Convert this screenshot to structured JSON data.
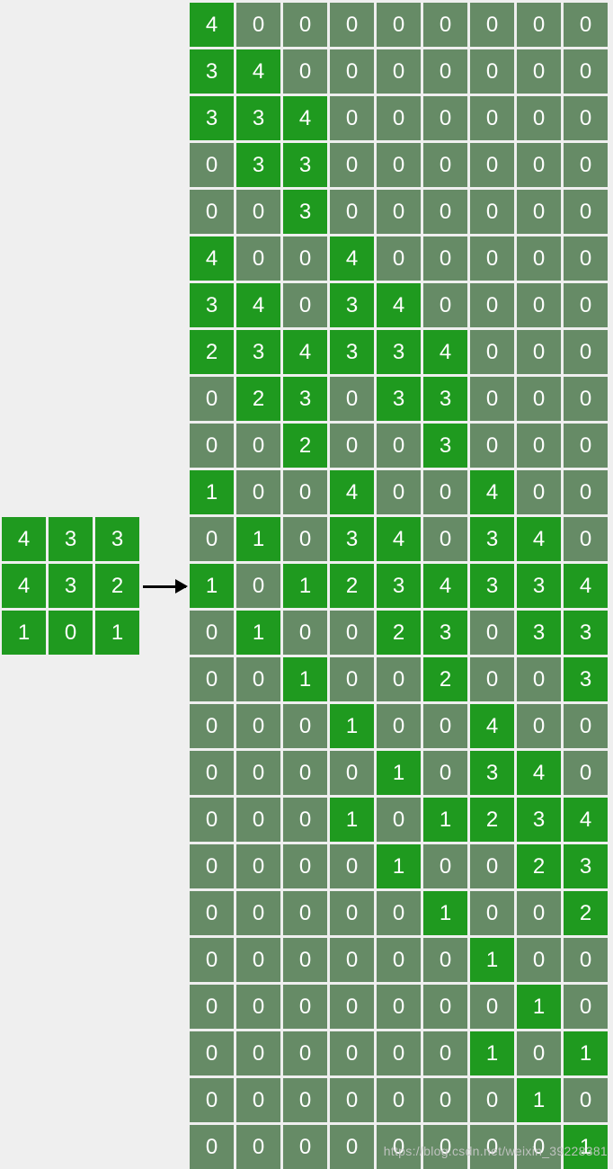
{
  "watermark": "https://blog.csdn.net/weixin_39228381",
  "left_matrix": {
    "rows": 3,
    "cols": 3,
    "cells": [
      [
        {
          "v": 4,
          "b": true
        },
        {
          "v": 3,
          "b": true
        },
        {
          "v": 3,
          "b": true
        }
      ],
      [
        {
          "v": 4,
          "b": true
        },
        {
          "v": 3,
          "b": true
        },
        {
          "v": 2,
          "b": true
        }
      ],
      [
        {
          "v": 1,
          "b": true
        },
        {
          "v": 0,
          "b": true
        },
        {
          "v": 1,
          "b": true
        }
      ]
    ]
  },
  "right_matrix": {
    "rows": 25,
    "cols": 9,
    "cells": [
      [
        {
          "v": 4,
          "b": true
        },
        {
          "v": 0,
          "b": false
        },
        {
          "v": 0,
          "b": false
        },
        {
          "v": 0,
          "b": false
        },
        {
          "v": 0,
          "b": false
        },
        {
          "v": 0,
          "b": false
        },
        {
          "v": 0,
          "b": false
        },
        {
          "v": 0,
          "b": false
        },
        {
          "v": 0,
          "b": false
        }
      ],
      [
        {
          "v": 3,
          "b": true
        },
        {
          "v": 4,
          "b": true
        },
        {
          "v": 0,
          "b": false
        },
        {
          "v": 0,
          "b": false
        },
        {
          "v": 0,
          "b": false
        },
        {
          "v": 0,
          "b": false
        },
        {
          "v": 0,
          "b": false
        },
        {
          "v": 0,
          "b": false
        },
        {
          "v": 0,
          "b": false
        }
      ],
      [
        {
          "v": 3,
          "b": true
        },
        {
          "v": 3,
          "b": true
        },
        {
          "v": 4,
          "b": true
        },
        {
          "v": 0,
          "b": false
        },
        {
          "v": 0,
          "b": false
        },
        {
          "v": 0,
          "b": false
        },
        {
          "v": 0,
          "b": false
        },
        {
          "v": 0,
          "b": false
        },
        {
          "v": 0,
          "b": false
        }
      ],
      [
        {
          "v": 0,
          "b": false
        },
        {
          "v": 3,
          "b": true
        },
        {
          "v": 3,
          "b": true
        },
        {
          "v": 0,
          "b": false
        },
        {
          "v": 0,
          "b": false
        },
        {
          "v": 0,
          "b": false
        },
        {
          "v": 0,
          "b": false
        },
        {
          "v": 0,
          "b": false
        },
        {
          "v": 0,
          "b": false
        }
      ],
      [
        {
          "v": 0,
          "b": false
        },
        {
          "v": 0,
          "b": false
        },
        {
          "v": 3,
          "b": true
        },
        {
          "v": 0,
          "b": false
        },
        {
          "v": 0,
          "b": false
        },
        {
          "v": 0,
          "b": false
        },
        {
          "v": 0,
          "b": false
        },
        {
          "v": 0,
          "b": false
        },
        {
          "v": 0,
          "b": false
        }
      ],
      [
        {
          "v": 4,
          "b": true
        },
        {
          "v": 0,
          "b": false
        },
        {
          "v": 0,
          "b": false
        },
        {
          "v": 4,
          "b": true
        },
        {
          "v": 0,
          "b": false
        },
        {
          "v": 0,
          "b": false
        },
        {
          "v": 0,
          "b": false
        },
        {
          "v": 0,
          "b": false
        },
        {
          "v": 0,
          "b": false
        }
      ],
      [
        {
          "v": 3,
          "b": true
        },
        {
          "v": 4,
          "b": true
        },
        {
          "v": 0,
          "b": false
        },
        {
          "v": 3,
          "b": true
        },
        {
          "v": 4,
          "b": true
        },
        {
          "v": 0,
          "b": false
        },
        {
          "v": 0,
          "b": false
        },
        {
          "v": 0,
          "b": false
        },
        {
          "v": 0,
          "b": false
        }
      ],
      [
        {
          "v": 2,
          "b": true
        },
        {
          "v": 3,
          "b": true
        },
        {
          "v": 4,
          "b": true
        },
        {
          "v": 3,
          "b": true
        },
        {
          "v": 3,
          "b": true
        },
        {
          "v": 4,
          "b": true
        },
        {
          "v": 0,
          "b": false
        },
        {
          "v": 0,
          "b": false
        },
        {
          "v": 0,
          "b": false
        }
      ],
      [
        {
          "v": 0,
          "b": false
        },
        {
          "v": 2,
          "b": true
        },
        {
          "v": 3,
          "b": true
        },
        {
          "v": 0,
          "b": false
        },
        {
          "v": 3,
          "b": true
        },
        {
          "v": 3,
          "b": true
        },
        {
          "v": 0,
          "b": false
        },
        {
          "v": 0,
          "b": false
        },
        {
          "v": 0,
          "b": false
        }
      ],
      [
        {
          "v": 0,
          "b": false
        },
        {
          "v": 0,
          "b": false
        },
        {
          "v": 2,
          "b": true
        },
        {
          "v": 0,
          "b": false
        },
        {
          "v": 0,
          "b": false
        },
        {
          "v": 3,
          "b": true
        },
        {
          "v": 0,
          "b": false
        },
        {
          "v": 0,
          "b": false
        },
        {
          "v": 0,
          "b": false
        }
      ],
      [
        {
          "v": 1,
          "b": true
        },
        {
          "v": 0,
          "b": false
        },
        {
          "v": 0,
          "b": false
        },
        {
          "v": 4,
          "b": true
        },
        {
          "v": 0,
          "b": false
        },
        {
          "v": 0,
          "b": false
        },
        {
          "v": 4,
          "b": true
        },
        {
          "v": 0,
          "b": false
        },
        {
          "v": 0,
          "b": false
        }
      ],
      [
        {
          "v": 0,
          "b": false
        },
        {
          "v": 1,
          "b": true
        },
        {
          "v": 0,
          "b": false
        },
        {
          "v": 3,
          "b": true
        },
        {
          "v": 4,
          "b": true
        },
        {
          "v": 0,
          "b": false
        },
        {
          "v": 3,
          "b": true
        },
        {
          "v": 4,
          "b": true
        },
        {
          "v": 0,
          "b": false
        }
      ],
      [
        {
          "v": 1,
          "b": true
        },
        {
          "v": 0,
          "b": false
        },
        {
          "v": 1,
          "b": true
        },
        {
          "v": 2,
          "b": true
        },
        {
          "v": 3,
          "b": true
        },
        {
          "v": 4,
          "b": true
        },
        {
          "v": 3,
          "b": true
        },
        {
          "v": 3,
          "b": true
        },
        {
          "v": 4,
          "b": true
        }
      ],
      [
        {
          "v": 0,
          "b": false
        },
        {
          "v": 1,
          "b": true
        },
        {
          "v": 0,
          "b": false
        },
        {
          "v": 0,
          "b": false
        },
        {
          "v": 2,
          "b": true
        },
        {
          "v": 3,
          "b": true
        },
        {
          "v": 0,
          "b": false
        },
        {
          "v": 3,
          "b": true
        },
        {
          "v": 3,
          "b": true
        }
      ],
      [
        {
          "v": 0,
          "b": false
        },
        {
          "v": 0,
          "b": false
        },
        {
          "v": 1,
          "b": true
        },
        {
          "v": 0,
          "b": false
        },
        {
          "v": 0,
          "b": false
        },
        {
          "v": 2,
          "b": true
        },
        {
          "v": 0,
          "b": false
        },
        {
          "v": 0,
          "b": false
        },
        {
          "v": 3,
          "b": true
        }
      ],
      [
        {
          "v": 0,
          "b": false
        },
        {
          "v": 0,
          "b": false
        },
        {
          "v": 0,
          "b": false
        },
        {
          "v": 1,
          "b": true
        },
        {
          "v": 0,
          "b": false
        },
        {
          "v": 0,
          "b": false
        },
        {
          "v": 4,
          "b": true
        },
        {
          "v": 0,
          "b": false
        },
        {
          "v": 0,
          "b": false
        }
      ],
      [
        {
          "v": 0,
          "b": false
        },
        {
          "v": 0,
          "b": false
        },
        {
          "v": 0,
          "b": false
        },
        {
          "v": 0,
          "b": false
        },
        {
          "v": 1,
          "b": true
        },
        {
          "v": 0,
          "b": false
        },
        {
          "v": 3,
          "b": true
        },
        {
          "v": 4,
          "b": true
        },
        {
          "v": 0,
          "b": false
        }
      ],
      [
        {
          "v": 0,
          "b": false
        },
        {
          "v": 0,
          "b": false
        },
        {
          "v": 0,
          "b": false
        },
        {
          "v": 1,
          "b": true
        },
        {
          "v": 0,
          "b": false
        },
        {
          "v": 1,
          "b": true
        },
        {
          "v": 2,
          "b": true
        },
        {
          "v": 3,
          "b": true
        },
        {
          "v": 4,
          "b": true
        }
      ],
      [
        {
          "v": 0,
          "b": false
        },
        {
          "v": 0,
          "b": false
        },
        {
          "v": 0,
          "b": false
        },
        {
          "v": 0,
          "b": false
        },
        {
          "v": 1,
          "b": true
        },
        {
          "v": 0,
          "b": false
        },
        {
          "v": 0,
          "b": false
        },
        {
          "v": 2,
          "b": true
        },
        {
          "v": 3,
          "b": true
        }
      ],
      [
        {
          "v": 0,
          "b": false
        },
        {
          "v": 0,
          "b": false
        },
        {
          "v": 0,
          "b": false
        },
        {
          "v": 0,
          "b": false
        },
        {
          "v": 0,
          "b": false
        },
        {
          "v": 1,
          "b": true
        },
        {
          "v": 0,
          "b": false
        },
        {
          "v": 0,
          "b": false
        },
        {
          "v": 2,
          "b": true
        }
      ],
      [
        {
          "v": 0,
          "b": false
        },
        {
          "v": 0,
          "b": false
        },
        {
          "v": 0,
          "b": false
        },
        {
          "v": 0,
          "b": false
        },
        {
          "v": 0,
          "b": false
        },
        {
          "v": 0,
          "b": false
        },
        {
          "v": 1,
          "b": true
        },
        {
          "v": 0,
          "b": false
        },
        {
          "v": 0,
          "b": false
        }
      ],
      [
        {
          "v": 0,
          "b": false
        },
        {
          "v": 0,
          "b": false
        },
        {
          "v": 0,
          "b": false
        },
        {
          "v": 0,
          "b": false
        },
        {
          "v": 0,
          "b": false
        },
        {
          "v": 0,
          "b": false
        },
        {
          "v": 0,
          "b": false
        },
        {
          "v": 1,
          "b": true
        },
        {
          "v": 0,
          "b": false
        }
      ],
      [
        {
          "v": 0,
          "b": false
        },
        {
          "v": 0,
          "b": false
        },
        {
          "v": 0,
          "b": false
        },
        {
          "v": 0,
          "b": false
        },
        {
          "v": 0,
          "b": false
        },
        {
          "v": 0,
          "b": false
        },
        {
          "v": 1,
          "b": true
        },
        {
          "v": 0,
          "b": false
        },
        {
          "v": 1,
          "b": true
        }
      ],
      [
        {
          "v": 0,
          "b": false
        },
        {
          "v": 0,
          "b": false
        },
        {
          "v": 0,
          "b": false
        },
        {
          "v": 0,
          "b": false
        },
        {
          "v": 0,
          "b": false
        },
        {
          "v": 0,
          "b": false
        },
        {
          "v": 0,
          "b": false
        },
        {
          "v": 1,
          "b": true
        },
        {
          "v": 0,
          "b": false
        }
      ],
      [
        {
          "v": 0,
          "b": false
        },
        {
          "v": 0,
          "b": false
        },
        {
          "v": 0,
          "b": false
        },
        {
          "v": 0,
          "b": false
        },
        {
          "v": 0,
          "b": false
        },
        {
          "v": 0,
          "b": false
        },
        {
          "v": 0,
          "b": false
        },
        {
          "v": 0,
          "b": false
        },
        {
          "v": 1,
          "b": true
        }
      ]
    ]
  }
}
